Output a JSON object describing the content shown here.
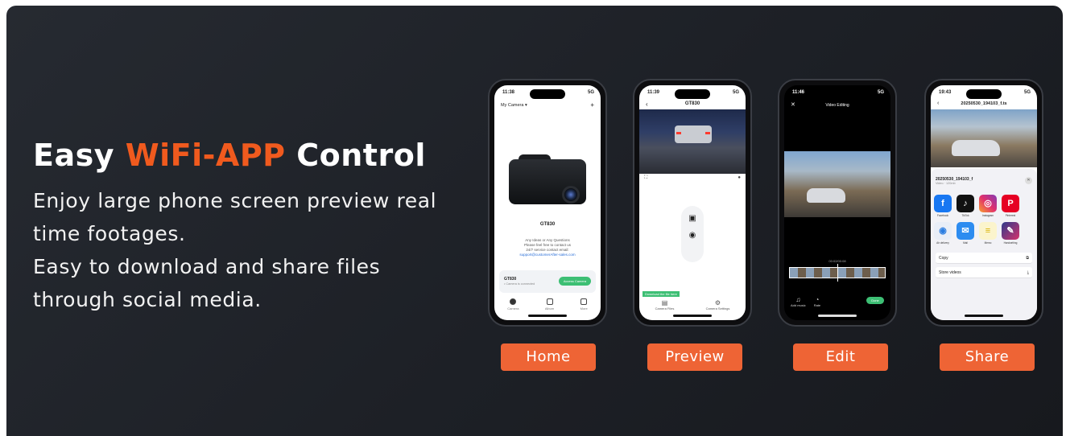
{
  "headline": {
    "prefix": "Easy ",
    "accent": "WiFi-APP",
    "suffix": " Control",
    "accent_color": "#f05a1e"
  },
  "description": {
    "line1": "Enjoy large phone screen preview real",
    "line2": "time footages.",
    "line3": "Easy to download and share files",
    "line4": "through social media."
  },
  "phones": {
    "home": {
      "time": "11:38",
      "signal": "5G",
      "title": "My Camera ▾",
      "plus": "+",
      "camera_model": "GT830",
      "support_line1": "Any Ideas or Any Questions",
      "support_line2": "Please feel free to contact us",
      "support_line3": "24/7 service contact email:",
      "support_email": "support@customerAfter-sales.com",
      "card_name": "GT830",
      "card_status": "• Camera is connected",
      "access_button": "Access Camera",
      "tabs": [
        "Camera",
        "Album",
        "More"
      ]
    },
    "preview": {
      "time": "11:39",
      "signal": "5G",
      "title": "GT830",
      "back": "‹",
      "download_hint": "Download the file here",
      "camera_files": "Camera Files",
      "camera_settings": "Camera Settings"
    },
    "edit": {
      "time": "11:46",
      "signal": "5G",
      "title": "Video Editing",
      "close": "✕",
      "timecode": "00:02/00:08",
      "add_music": "Add music",
      "rate": "Rate",
      "done": "Done"
    },
    "share": {
      "time": "19:43",
      "signal": "5G",
      "title": "20250530_194103_f.ts",
      "back": "‹",
      "file_name": "20250530_194103_f",
      "file_meta": "Video · 120mb",
      "close": "✕",
      "apps_row1": [
        "Facebook",
        "TikTok",
        "Instagram",
        "Pinterest"
      ],
      "apps_row2": [
        "Air delivery",
        "Mail",
        "Memo",
        "Handwriting"
      ],
      "copy": "Copy",
      "store": "Store videos"
    }
  },
  "labels": {
    "home": "Home",
    "preview": "Preview",
    "edit": "Edit",
    "share": "Share",
    "pill_color": "#ee6435"
  }
}
